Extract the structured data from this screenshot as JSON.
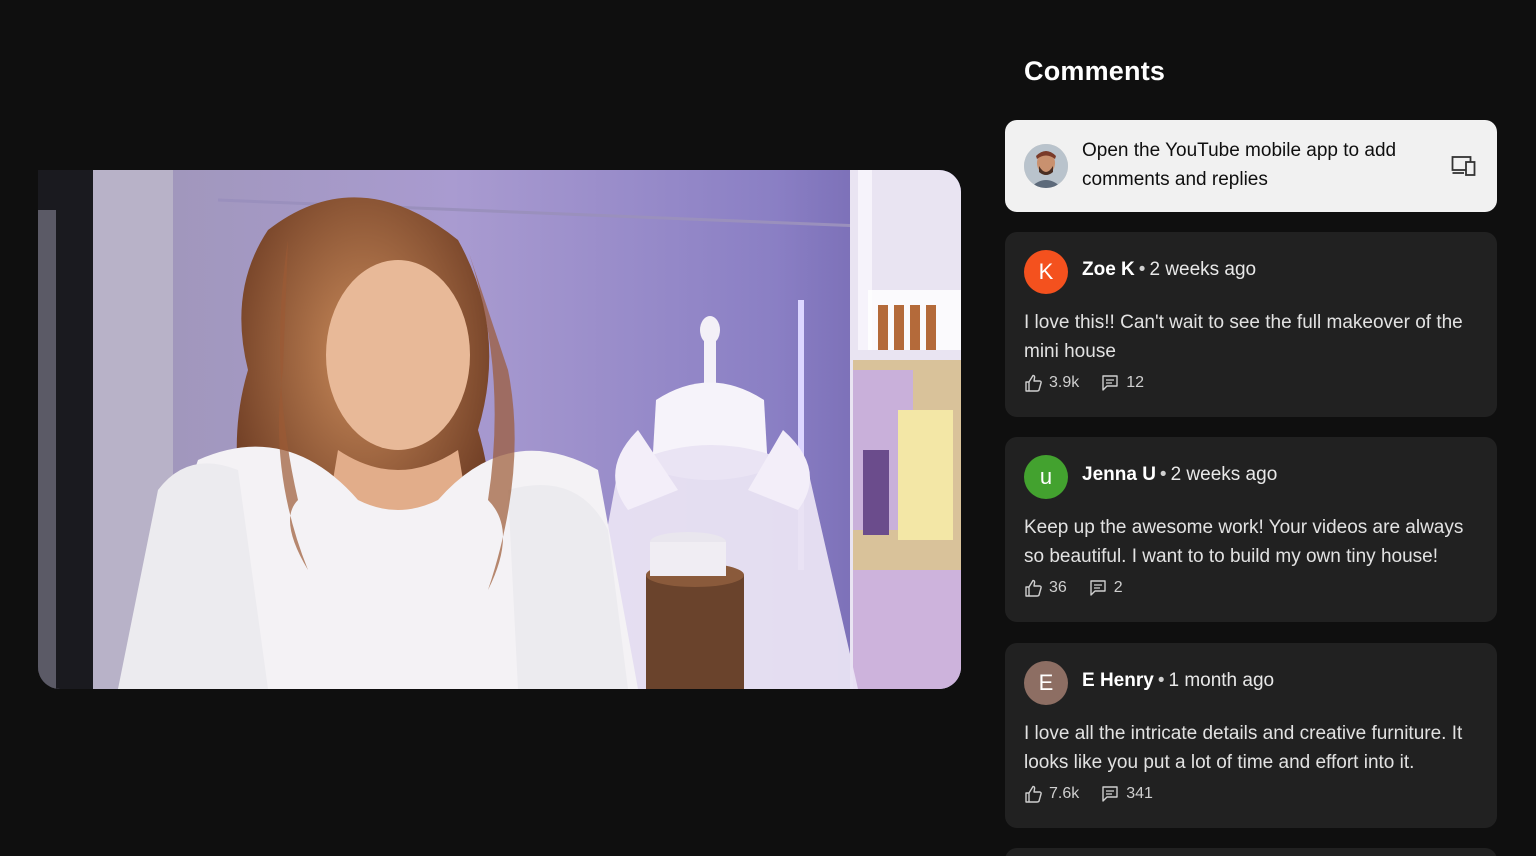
{
  "panel": {
    "title": "Comments"
  },
  "notice": {
    "line": "Open the YouTube mobile app to add comments and replies",
    "icon": "devices-icon"
  },
  "comments": [
    {
      "avatar_letter": "K",
      "avatar_color": "#f4511e",
      "author": "Zoe K",
      "time": "2 weeks ago",
      "text": "I love this!! Can't wait to see the full makeover of the mini house",
      "likes": "3.9k",
      "replies": "12"
    },
    {
      "avatar_letter": "u",
      "avatar_color": "#43a22f",
      "author": "Jenna U",
      "time": "2 weeks ago",
      "text": "Keep up the awesome work! Your videos are always so beautiful. I want to to build my own tiny house!",
      "likes": "36",
      "replies": "2"
    },
    {
      "avatar_letter": "E",
      "avatar_color": "#8d6e63",
      "author": "E Henry",
      "time": "1 month ago",
      "text": "I love all the intricate details and creative furniture. It looks like you put a lot of time and effort into it.",
      "likes": "7.6k",
      "replies": "341"
    }
  ],
  "icons": {
    "like": "thumb-up-icon",
    "reply": "comment-icon"
  }
}
